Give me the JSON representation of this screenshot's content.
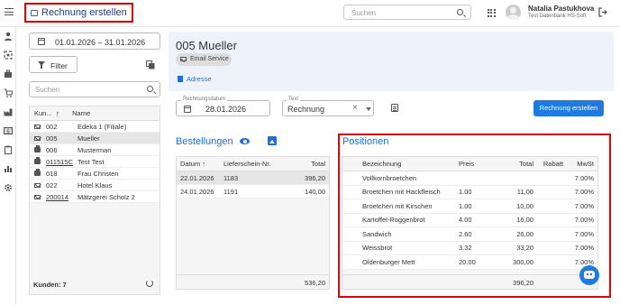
{
  "header": {
    "page_title": "Rechnung erstellen",
    "search_placeholder": "Suchen",
    "user_name": "Natalia Pastukhova",
    "user_sub": "Test Datenbank HS-Soft"
  },
  "left": {
    "date_range": "01.01.2026 – 31.01.2026",
    "filter_label": "Filter",
    "search_placeholder": "Suchen",
    "columns": [
      "Kun...",
      "Name"
    ],
    "customers": [
      {
        "icon": "email",
        "nr": "002",
        "name": "Edeka 1 (Filiale)",
        "link": false
      },
      {
        "icon": "email",
        "nr": "005",
        "name": "Mueller",
        "link": false
      },
      {
        "icon": "print",
        "nr": "006",
        "name": "Musterman",
        "link": false
      },
      {
        "icon": "print",
        "nr": "011515C",
        "name": "Test Test",
        "link": true
      },
      {
        "icon": "print",
        "nr": "018",
        "name": "Frau Christen",
        "link": false
      },
      {
        "icon": "email",
        "nr": "022",
        "name": "Hotel Klaus",
        "link": false
      },
      {
        "icon": "email",
        "nr": "200014",
        "name": "Mätzgerei Scholz 2",
        "link": true
      }
    ],
    "count_label": "Kunden: 7"
  },
  "customer": {
    "title": "005 Mueller",
    "chip": "Email Service",
    "adresse": "Adresse"
  },
  "form": {
    "date_label": "Rechnungsdatum",
    "date_value": "28.01.2026",
    "text_label": "Text",
    "text_value": "Rechnung",
    "create_button": "Rechnung erstellen"
  },
  "bestellungen": {
    "title": "Bestellungen",
    "columns": [
      "Datum",
      "Lieferschein-Nr.",
      "Total"
    ],
    "rows": [
      {
        "datum": "22.01.2026",
        "nr": "1183",
        "total": "396,20"
      },
      {
        "datum": "24.01.2026",
        "nr": "1191",
        "total": "140,00"
      }
    ],
    "sum": "536,20"
  },
  "positionen": {
    "title": "Positionen",
    "columns": [
      "Bezeichnung",
      "Preis",
      "Total",
      "Rabatt",
      "MwSt"
    ],
    "rows": [
      {
        "bez": "Vollkornbroetchen",
        "preis": "",
        "total": "",
        "rabatt": "",
        "mwst": "7.00%"
      },
      {
        "bez": "Broetchen mit Hackfleisch",
        "preis": "1.00",
        "total": "11,00",
        "rabatt": "",
        "mwst": "7.00%"
      },
      {
        "bez": "Broetchen mit Kirschen",
        "preis": "1.00",
        "total": "10,00",
        "rabatt": "",
        "mwst": "7.00%"
      },
      {
        "bez": "Kartoffel-Roggenbrot",
        "preis": "4.00",
        "total": "16,00",
        "rabatt": "",
        "mwst": "7.00%"
      },
      {
        "bez": "Sandwich",
        "preis": "2.60",
        "total": "26,00",
        "rabatt": "",
        "mwst": "7.00%"
      },
      {
        "bez": "Weissbrot",
        "preis": "3.32",
        "total": "33,20",
        "rabatt": "",
        "mwst": "7.00%"
      },
      {
        "bez": "Oldenburger Mett",
        "preis": "20.00",
        "total": "300,00",
        "rabatt": "",
        "mwst": "7.00%"
      }
    ],
    "sum": "396,20"
  }
}
